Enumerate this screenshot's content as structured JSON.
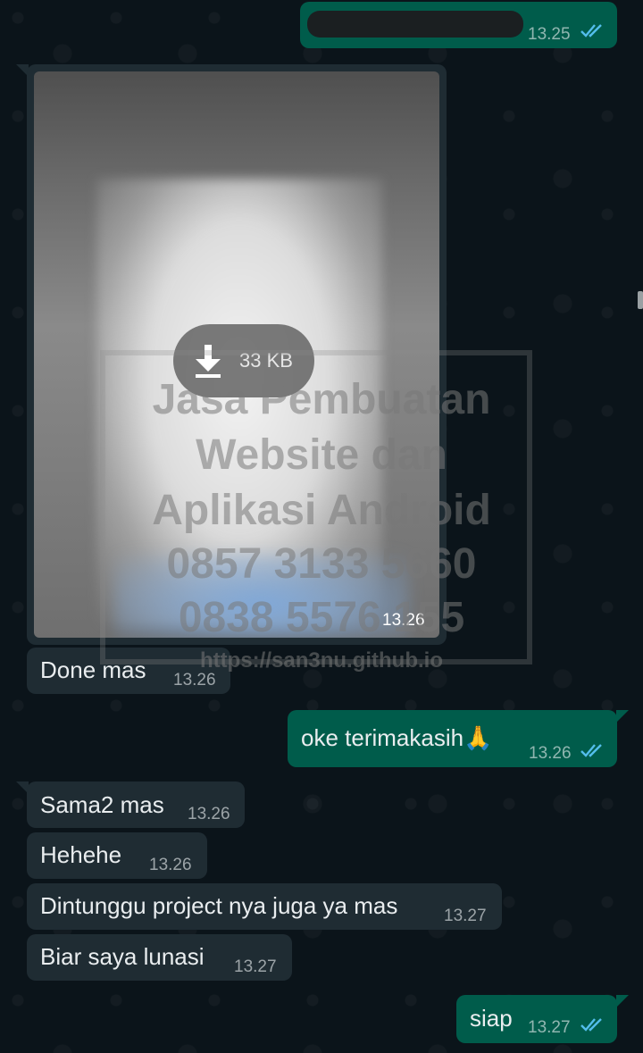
{
  "messages": {
    "m0": {
      "time": "13.25"
    },
    "image": {
      "size": "33 KB",
      "time": "13.26"
    },
    "m1": {
      "text": "Done mas",
      "time": "13.26"
    },
    "m2": {
      "text": "oke terimakasih🙏",
      "time": "13.26"
    },
    "m3": {
      "text": "Sama2 mas",
      "time": "13.26"
    },
    "m4": {
      "text": "Hehehe",
      "time": "13.26"
    },
    "m5": {
      "text": "Dintunggu project nya juga ya mas",
      "time": "13.27"
    },
    "m6": {
      "text": "Biar saya lunasi",
      "time": "13.27"
    },
    "m7": {
      "text": "siap",
      "time": "13.27"
    }
  },
  "watermark": {
    "line1": "Jasa Pembuatan",
    "line2": "Website dan",
    "line3": "Aplikasi Android",
    "line4": "0857 3133 5660",
    "line5": "0838 5576 155",
    "line6": "https://san3nu.github.io"
  },
  "colors": {
    "background": "#0b141a",
    "outgoing_bubble": "#005c4b",
    "incoming_bubble": "#1f2c33",
    "read_ticks": "#53bdeb"
  },
  "icons": {
    "read_receipt": "double-check-icon",
    "download": "download-arrow-icon"
  }
}
